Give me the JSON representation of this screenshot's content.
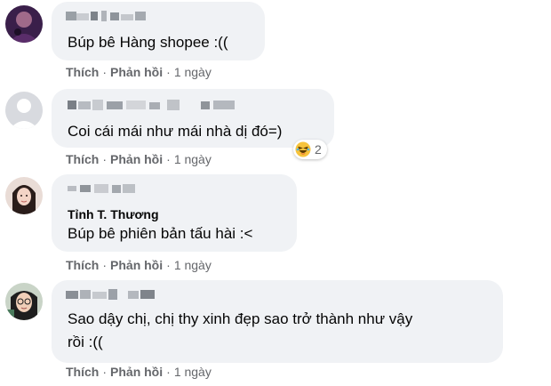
{
  "comments": [
    {
      "author": "",
      "text_lines": [
        "Búp bê Hàng shopee :(("
      ],
      "actions": {
        "like": "Thích",
        "reply": "Phản hồi",
        "time": "1 ngày"
      }
    },
    {
      "author": "",
      "text_lines": [
        "Coi cái mái như mái nhà dị đó=)"
      ],
      "actions": {
        "like": "Thích",
        "reply": "Phản hồi",
        "time": "1 ngày"
      },
      "reaction": {
        "icon": "laughing-emoji-icon",
        "count": "2"
      }
    },
    {
      "author": "",
      "tagged_name": "Tỉnh T. Thương",
      "text_lines": [
        "Búp bê phiên bản tấu hài :<"
      ],
      "actions": {
        "like": "Thích",
        "reply": "Phản hồi",
        "time": "1 ngày"
      }
    },
    {
      "author": "",
      "text_lines": [
        "Sao dậy chị, chị thy xinh đẹp sao trở thành như vậy",
        "rồi :(("
      ],
      "actions": {
        "like": "Thích",
        "reply": "Phản hồi",
        "time": "1 ngày"
      }
    }
  ],
  "colors": {
    "bubble": "#f0f2f5",
    "meta_text": "#65676b",
    "body_text": "#050505"
  }
}
